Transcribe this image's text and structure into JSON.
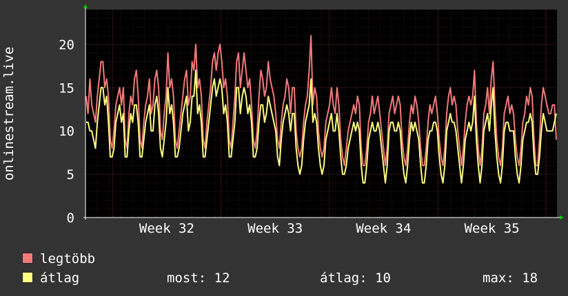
{
  "chart_data": {
    "type": "line",
    "ylabel": "onlinestream.live",
    "ylim": [
      0,
      24
    ],
    "yticks": [
      0,
      5,
      10,
      15,
      20
    ],
    "x_tick_labels": [
      "Week 32",
      "Week 33",
      "Week 34",
      "Week 35"
    ],
    "grid": true,
    "legend_position": "bottom",
    "colors": {
      "background": "#333333",
      "plot_background": "#000000",
      "grid_minor": "#3a1818",
      "grid_major": "#5a2222",
      "axis": "#ffffff",
      "arrow": "#00cc00",
      "series_max": "#f47a7a",
      "series_avg": "#ffff80"
    },
    "series": [
      {
        "name": "legtöbb",
        "color": "#f47a7a",
        "values": [
          14,
          12,
          16,
          13,
          12,
          11,
          14,
          16,
          18,
          18,
          15,
          16,
          14,
          9,
          8,
          10,
          13,
          14,
          15,
          13,
          15,
          9,
          8,
          12,
          14,
          13,
          16,
          17,
          14,
          9,
          8,
          11,
          13,
          14,
          16,
          12,
          13,
          16,
          17,
          15,
          10,
          9,
          12,
          14,
          19,
          15,
          16,
          14,
          9,
          8,
          10,
          12,
          14,
          16,
          17,
          13,
          14,
          18,
          17,
          20,
          15,
          16,
          14,
          9,
          8,
          11,
          13,
          15,
          18,
          19,
          17,
          19,
          20,
          18,
          15,
          16,
          14,
          9,
          8,
          11,
          14,
          18,
          19,
          15,
          17,
          19,
          17,
          15,
          16,
          13,
          9,
          8,
          10,
          14,
          17,
          16,
          14,
          15,
          18,
          16,
          15,
          14,
          12,
          9,
          8,
          11,
          13,
          14,
          16,
          15,
          12,
          15,
          15,
          10,
          8,
          7,
          8,
          11,
          13,
          14,
          17,
          21,
          13,
          15,
          14,
          10,
          8,
          7,
          8,
          11,
          12,
          13,
          15,
          13,
          12,
          15,
          13,
          9,
          7,
          6,
          8,
          10,
          11,
          12,
          13,
          12,
          14,
          13,
          8,
          6,
          6,
          8,
          11,
          12,
          14,
          12,
          13,
          14,
          12,
          10,
          8,
          6,
          8,
          12,
          13,
          14,
          12,
          13,
          14,
          13,
          9,
          7,
          6,
          8,
          11,
          13,
          12,
          14,
          13,
          11,
          8,
          6,
          6,
          8,
          11,
          13,
          12,
          13,
          14,
          12,
          9,
          7,
          6,
          8,
          12,
          14,
          15,
          13,
          14,
          13,
          10,
          8,
          6,
          8,
          11,
          13,
          14,
          13,
          14,
          17,
          11,
          8,
          6,
          8,
          12,
          13,
          15,
          12,
          16,
          18,
          13,
          9,
          7,
          6,
          8,
          12,
          13,
          14,
          12,
          13,
          12,
          9,
          7,
          6,
          8,
          11,
          12,
          14,
          13,
          15,
          14,
          9,
          6,
          6,
          9,
          13,
          15,
          14,
          13,
          12,
          12,
          13,
          13,
          9
        ],
        "note": ""
      },
      {
        "name": "átlag",
        "color": "#ffff80",
        "values": [
          11,
          11,
          10,
          10,
          9,
          8,
          11,
          13,
          15,
          15,
          13,
          14,
          11,
          7,
          7,
          8,
          11,
          12,
          13,
          11,
          12,
          7,
          7,
          10,
          12,
          11,
          13,
          13,
          11,
          7,
          7,
          9,
          11,
          12,
          13,
          10,
          10,
          13,
          14,
          12,
          8,
          7,
          9,
          11,
          15,
          12,
          13,
          11,
          7,
          7,
          8,
          10,
          12,
          13,
          14,
          10,
          11,
          14,
          14,
          17,
          12,
          13,
          11,
          7,
          7,
          9,
          11,
          13,
          15,
          16,
          14,
          15,
          16,
          15,
          12,
          13,
          11,
          7,
          7,
          9,
          11,
          15,
          15,
          12,
          14,
          15,
          14,
          12,
          13,
          11,
          7,
          7,
          8,
          11,
          13,
          13,
          11,
          12,
          14,
          13,
          12,
          11,
          10,
          7,
          6,
          9,
          11,
          12,
          13,
          12,
          10,
          12,
          12,
          8,
          6,
          5,
          6,
          9,
          11,
          12,
          13,
          16,
          11,
          12,
          11,
          8,
          6,
          5,
          6,
          9,
          10,
          11,
          12,
          10,
          10,
          12,
          10,
          7,
          5,
          5,
          6,
          8,
          9,
          10,
          11,
          10,
          11,
          10,
          6,
          4,
          4,
          6,
          9,
          10,
          11,
          10,
          10,
          11,
          10,
          8,
          6,
          4,
          6,
          10,
          11,
          11,
          10,
          10,
          11,
          10,
          7,
          5,
          4,
          6,
          9,
          11,
          10,
          11,
          10,
          9,
          6,
          4,
          4,
          6,
          9,
          10,
          10,
          11,
          11,
          10,
          7,
          5,
          4,
          6,
          10,
          11,
          12,
          11,
          11,
          10,
          8,
          6,
          4,
          6,
          9,
          10,
          11,
          10,
          11,
          14,
          9,
          6,
          4,
          6,
          10,
          11,
          12,
          10,
          13,
          15,
          10,
          7,
          5,
          4,
          6,
          10,
          11,
          11,
          10,
          10,
          10,
          7,
          5,
          4,
          6,
          9,
          10,
          11,
          11,
          12,
          11,
          7,
          5,
          5,
          7,
          10,
          12,
          11,
          10,
          10,
          10,
          10,
          11,
          12
        ]
      }
    ]
  },
  "legend": {
    "items": [
      {
        "label": "legtöbb",
        "color": "#f47a7a"
      },
      {
        "label": "átlag",
        "color": "#ffff80"
      }
    ],
    "stats": {
      "now_label": "most:",
      "now_value": "12",
      "avg_label": "átlag:",
      "avg_value": "10",
      "max_label": "max:",
      "max_value": "18"
    }
  }
}
